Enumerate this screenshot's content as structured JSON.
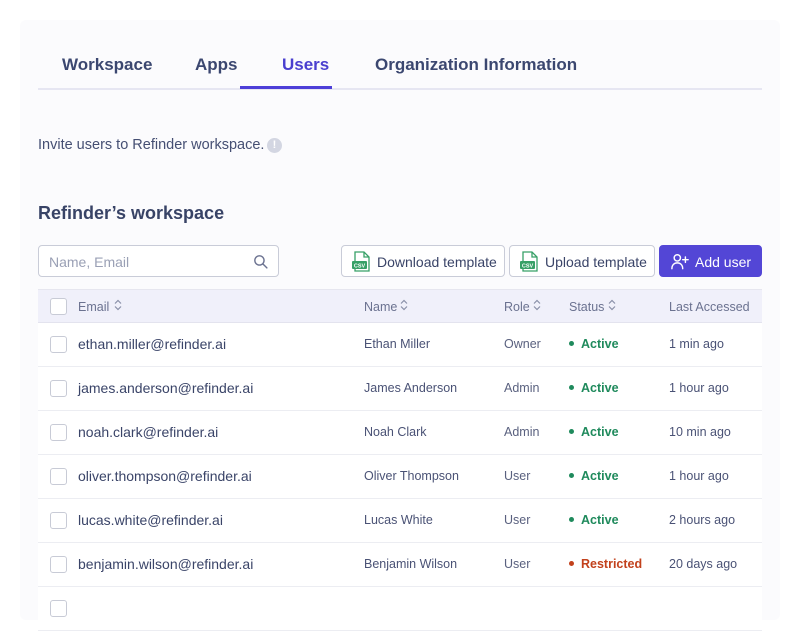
{
  "tabs": [
    {
      "label": "Workspace"
    },
    {
      "label": "Apps"
    },
    {
      "label": "Users"
    },
    {
      "label": "Organization Information"
    }
  ],
  "active_tab": "Users",
  "invite_text": "Invite users to Refinder workspace.",
  "workspace_title": "Refinder’s workspace",
  "search": {
    "placeholder": "Name, Email",
    "value": ""
  },
  "buttons": {
    "download": "Download template",
    "upload": "Upload template",
    "add_user": "Add user"
  },
  "icons": {
    "csv": "csv-file-icon",
    "search": "search-icon",
    "add_user": "user-plus-icon",
    "info": "info-icon"
  },
  "colors": {
    "accent": "#5346d6",
    "active": "#1f8a5c",
    "restricted": "#c2411c"
  },
  "table": {
    "columns": [
      "Email",
      "Name",
      "Role",
      "Status",
      "Last Accessed"
    ],
    "rows": [
      {
        "email": "ethan.miller@refinder.ai",
        "name": "Ethan Miller",
        "role": "Owner",
        "status": "Active",
        "last": "1 min ago"
      },
      {
        "email": "james.anderson@refinder.ai",
        "name": "James Anderson",
        "role": "Admin",
        "status": "Active",
        "last": "1 hour ago"
      },
      {
        "email": "noah.clark@refinder.ai",
        "name": "Noah Clark",
        "role": "Admin",
        "status": "Active",
        "last": "10 min ago"
      },
      {
        "email": "oliver.thompson@refinder.ai",
        "name": "Oliver Thompson",
        "role": "User",
        "status": "Active",
        "last": "1 hour ago"
      },
      {
        "email": "lucas.white@refinder.ai",
        "name": "Lucas White",
        "role": "User",
        "status": "Active",
        "last": "2 hours ago"
      },
      {
        "email": "benjamin.wilson@refinder.ai",
        "name": "Benjamin Wilson",
        "role": "User",
        "status": "Restricted",
        "last": "20 days ago"
      }
    ]
  }
}
